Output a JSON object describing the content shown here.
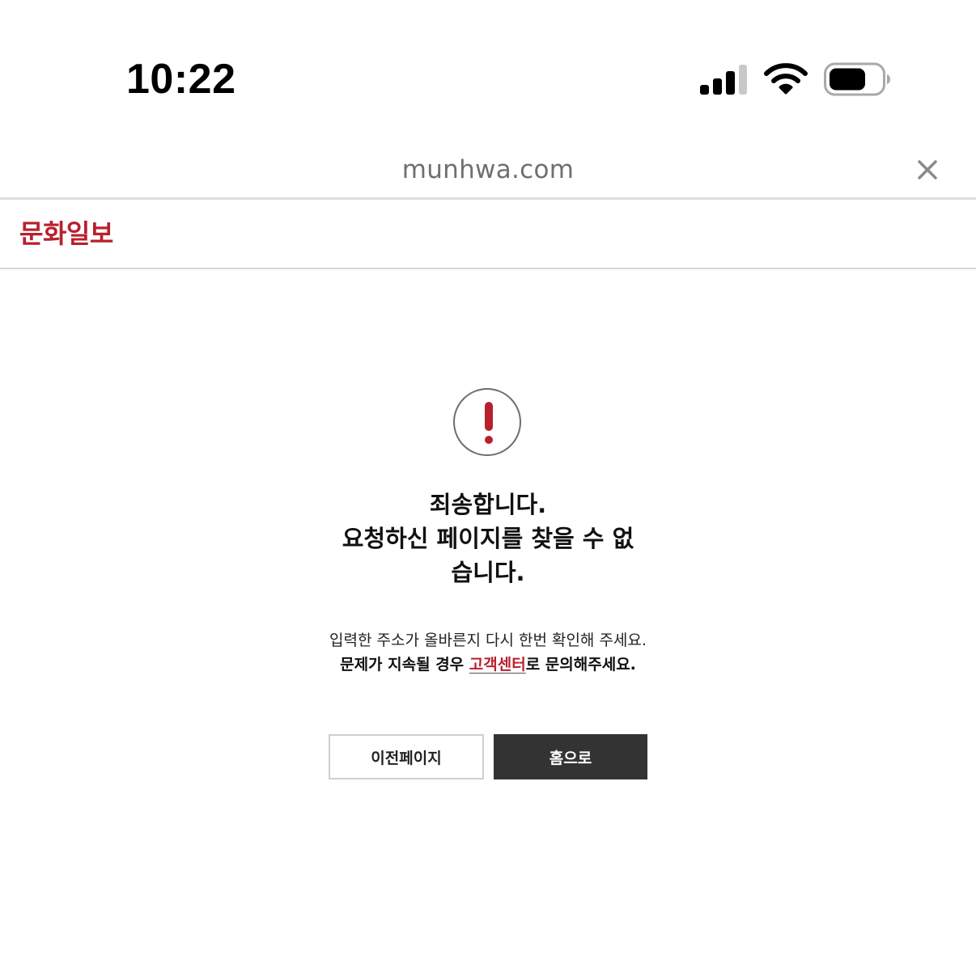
{
  "status_bar": {
    "time": "10:22",
    "icons": [
      "cellular-signal-icon",
      "wifi-icon",
      "battery-icon"
    ]
  },
  "browser": {
    "url": "munhwa.com",
    "close_icon": "close-icon"
  },
  "header": {
    "logo_text": "문화일보"
  },
  "error": {
    "icon": "exclamation-circle-icon",
    "title_lines": [
      "죄송합니다.",
      "요청하신 페이지를 찾을 수 없",
      "습니다."
    ],
    "desc_line1": "입력한 주소가 올바른지 다시 한번 확인해 주세요.",
    "desc_line2_prefix": "문제가 지속될 경우 ",
    "desc_line2_link": "고객센터",
    "desc_line2_suffix": "로 문의해주세요.",
    "buttons": {
      "prev_label": "이전페이지",
      "home_label": "홈으로"
    }
  },
  "colors": {
    "accent": "#b8202e",
    "home_button_bg": "#333333",
    "url_text": "#6f6f6f"
  }
}
